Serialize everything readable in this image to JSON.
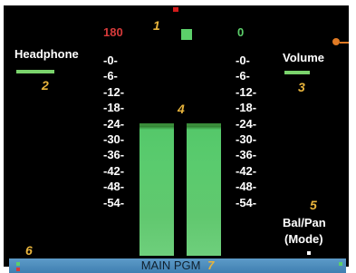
{
  "header": {
    "peak_left": "180",
    "peak_right": "0",
    "marker_1": "1"
  },
  "left_panel": {
    "label": "Headphone",
    "marker": "2"
  },
  "right_panel": {
    "label": "Volume",
    "marker": "3"
  },
  "meter_marker": "4",
  "mode": {
    "marker": "5",
    "line1": "Bal/Pan",
    "line2": "(Mode)"
  },
  "corner_marker": "6",
  "footer": {
    "label": "MAIN PGM",
    "marker": "7"
  },
  "scale_labels": [
    "-0-",
    "-6-",
    "-12-",
    "-18-",
    "-24-",
    "-30-",
    "-36-",
    "-42-",
    "-48-",
    "-54-"
  ],
  "meters": [
    {
      "channel": "left",
      "level_db": -18
    },
    {
      "channel": "right",
      "level_db": -18
    }
  ],
  "colors": {
    "peak_left": "#d63a3a",
    "peak_right": "#5ccf6a",
    "meter": "#5acb6e",
    "marker": "#e8b43c",
    "footer": "#4a8cbe"
  }
}
